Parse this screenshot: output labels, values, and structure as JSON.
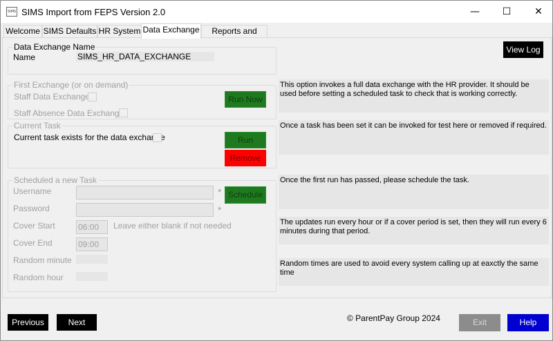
{
  "window": {
    "title": "SIMS Import from FEPS Version 2.0",
    "app_icon_text": "SIMS",
    "minimize_glyph": "—",
    "maximize_glyph": "☐",
    "close_glyph": "✕"
  },
  "tabs": [
    {
      "label": "Welcome"
    },
    {
      "label": "SIMS Defaults"
    },
    {
      "label": "HR System"
    },
    {
      "label": "Data Exchange"
    },
    {
      "label": "Reports and Tools"
    }
  ],
  "exchange_name_group": {
    "title": "Data Exchange Name",
    "name_label": "Name",
    "name_value": "SIMS_HR_DATA_EXCHANGE"
  },
  "view_log_label": "View Log",
  "first_exchange": {
    "title": "First Exchange (or on demand)",
    "staff_data_label": "Staff Data Exchange",
    "staff_absence_label": "Staff Absence Data Exchange",
    "run_now_label": "Run Now",
    "description": "This option invokes a full data exchange with the HR provider. It should be used before setting a scheduled task to check that is working correctly."
  },
  "current_task": {
    "title": "Current Task",
    "exists_label": "Current task exists for the data exchange",
    "run_label": "Run",
    "remove_label": "Remove",
    "description": "Once a task has been set it can be invoked for test here or removed if required."
  },
  "schedule": {
    "title": "Scheduled a new Task",
    "username_label": "Username",
    "password_label": "Password",
    "required_mark": "*",
    "schedule_label": "Schedule",
    "schedule_description": "Once the first run has passed, please schedule the task.",
    "cover_start_label": "Cover Start",
    "cover_start_value": "06:00",
    "cover_end_label": "Cover End",
    "cover_end_value": "09:00",
    "cover_hint": "Leave either blank if not needed",
    "cover_description": "The updates run every hour or if a cover period is set, then they will run every 6 minutes during that period.",
    "random_minute_label": "Random minute",
    "random_hour_label": "Random hour",
    "random_description": "Random times are used to avoid every system calling up at eaxctly the same time"
  },
  "footer": {
    "previous_label": "Previous",
    "next_label": "Next",
    "copyright": "© ParentPay Group 2024",
    "exit_label": "Exit",
    "help_label": "Help"
  },
  "colors": {
    "green_button": "#1f7a1f",
    "red_button": "#ff0000",
    "help_button": "#0000d0",
    "exit_button": "#8c8c8c"
  }
}
